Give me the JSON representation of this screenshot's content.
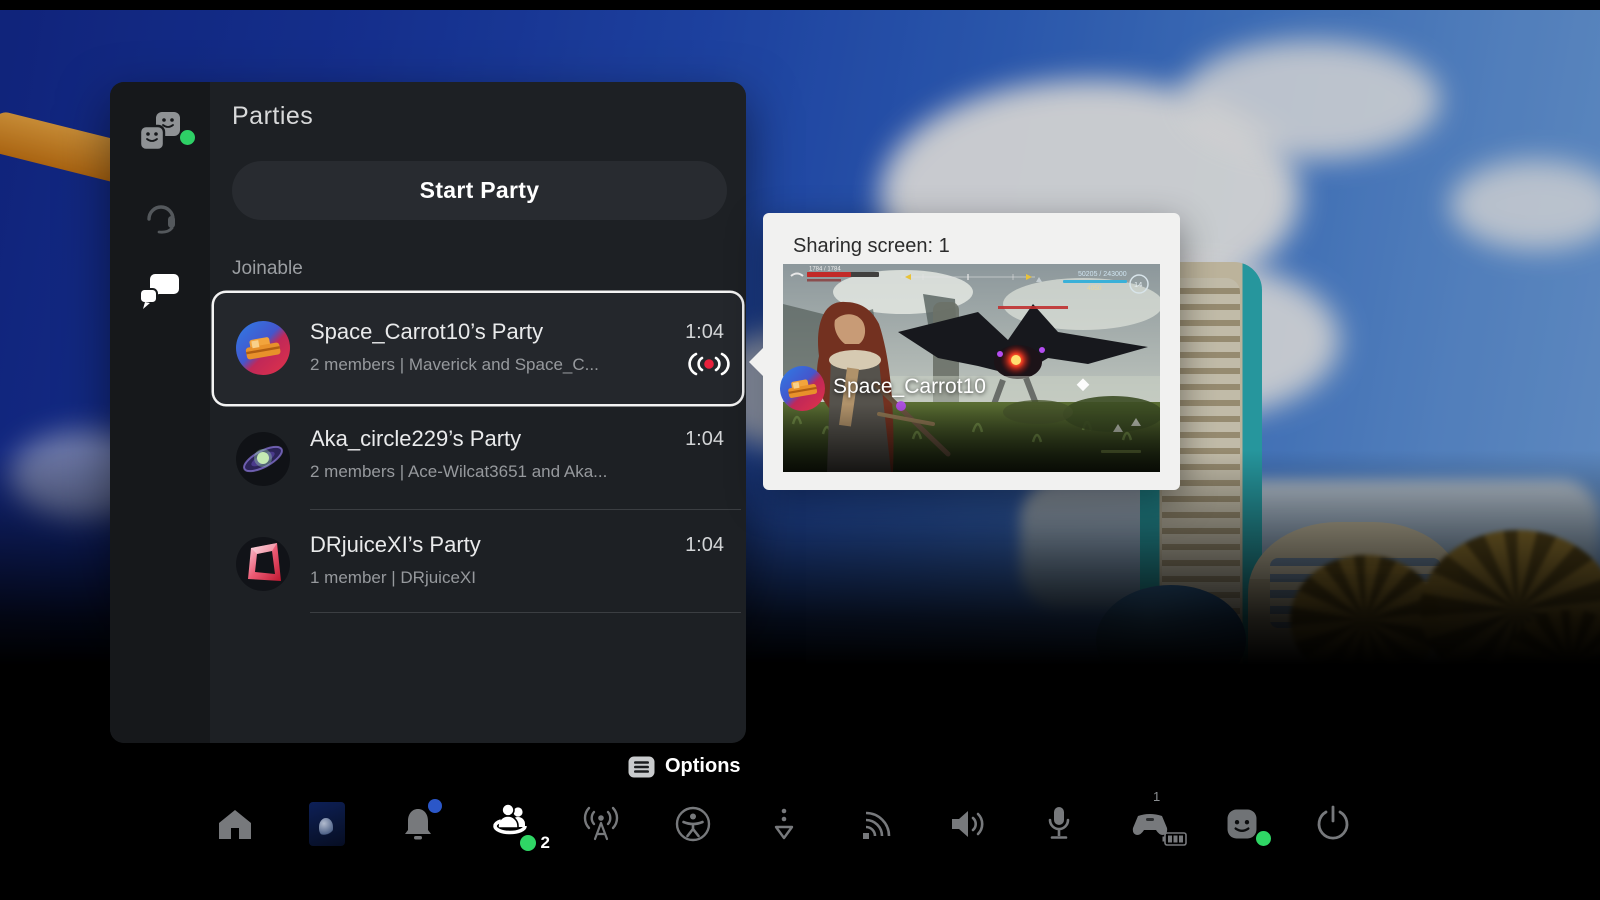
{
  "header": {
    "title": "Parties"
  },
  "sidebar": {
    "items": [
      {
        "name": "game-base",
        "online_badge": true
      },
      {
        "name": "voice-chat"
      },
      {
        "name": "messages"
      }
    ]
  },
  "panel": {
    "start_party_label": "Start Party",
    "section_label": "Joinable",
    "parties": [
      {
        "name": "Space_Carrot10’s Party",
        "members": "2 members | Maverick and Space_C...",
        "time": "1:04",
        "recording": true,
        "selected": true
      },
      {
        "name": "Aka_circle229’s Party",
        "members": "2 members | Ace-Wilcat3651 and Aka...",
        "time": "1:04"
      },
      {
        "name": "DRjuiceXI’s Party",
        "members": "1 member | DRjuiceXI",
        "time": "1:04"
      }
    ]
  },
  "popup": {
    "title": "Sharing screen: 1",
    "sharer_name": "Space_Carrot10"
  },
  "footer": {
    "options_label": "Options",
    "party_count": "2",
    "controller_number": "1",
    "nav_icons": [
      "home",
      "current-game",
      "notifications",
      "party",
      "broadcast",
      "accessibility",
      "downloads",
      "network",
      "volume",
      "microphone",
      "controller",
      "profile",
      "power"
    ]
  },
  "colors": {
    "accent_green": "#2fd665",
    "notification_blue": "#2b57c8",
    "record_red": "#e8203c"
  }
}
